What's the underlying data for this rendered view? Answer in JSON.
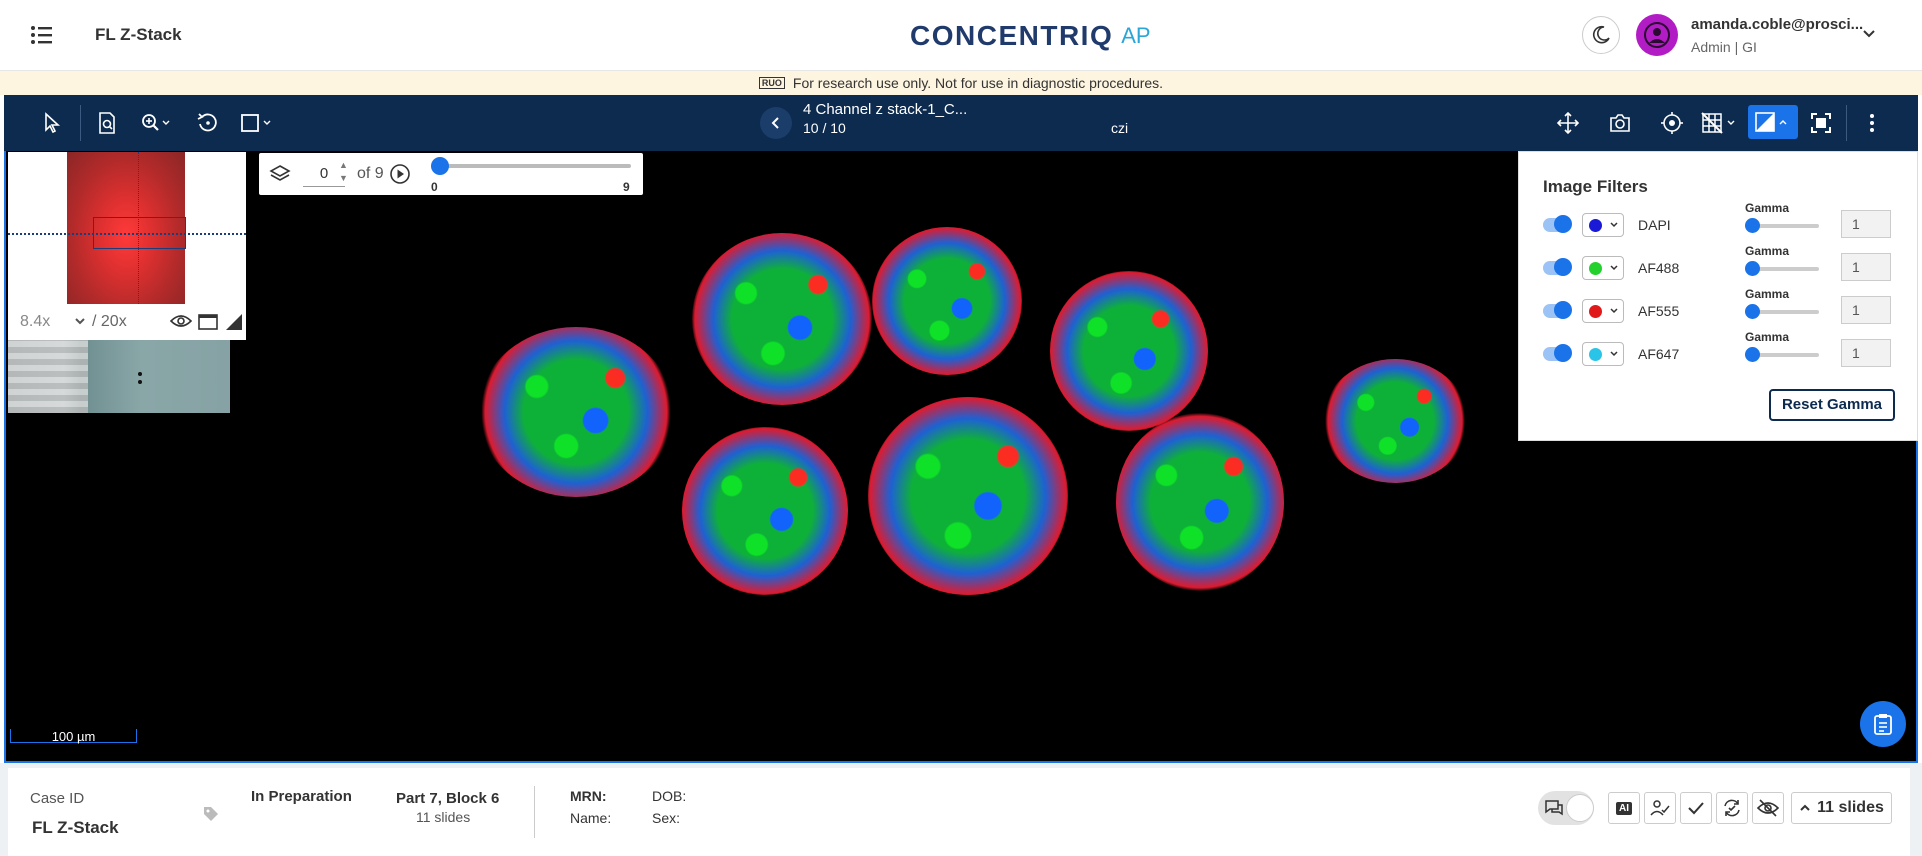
{
  "header": {
    "app_title": "FL Z-Stack",
    "brand": "CONCENTRIQ",
    "brand_suffix": "AP",
    "user_email": "amanda.coble@prosci...",
    "user_role": "Admin | GI"
  },
  "notice": {
    "badge": "RUO",
    "text": "For research use only. Not for use in diagnostic procedures."
  },
  "toolbar": {
    "slide_name": "4 Channel z stack-1_C...",
    "slide_position": "10 / 10",
    "file_type": "czi"
  },
  "overview": {
    "zoom_value": "8.4x",
    "zoom_max": "/ 20x"
  },
  "zstack": {
    "current": "0",
    "of_label": "of 9",
    "range_min": "0",
    "range_max": "9",
    "position": 0
  },
  "viewer": {
    "scale_bar": "100 µm"
  },
  "filters": {
    "title": "Image Filters",
    "gamma_label": "Gamma",
    "channels": [
      {
        "name": "DAPI",
        "color": "#1a1ad6",
        "gamma": "1"
      },
      {
        "name": "AF488",
        "color": "#22d12c",
        "gamma": "1"
      },
      {
        "name": "AF555",
        "color": "#e01a1a",
        "gamma": "1"
      },
      {
        "name": "AF647",
        "color": "#2ac4e8",
        "gamma": "1"
      }
    ],
    "reset_label": "Reset Gamma"
  },
  "case": {
    "case_id_label": "Case ID",
    "case_id": "FL Z-Stack",
    "status": "In Preparation",
    "part_block": "Part 7, Block 6",
    "slide_count": "11 slides",
    "mrn_label": "MRN:",
    "name_label": "Name:",
    "dob_label": "DOB:",
    "sex_label": "Sex:",
    "slides_button": "11 slides",
    "ai_label": "AI"
  },
  "colors": {
    "toolbar_bg": "#0d2b4f",
    "accent": "#1a73e8",
    "notice_bg": "#fdf5e0"
  }
}
